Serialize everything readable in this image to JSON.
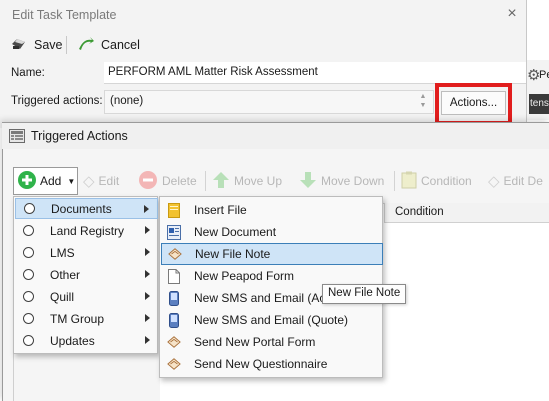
{
  "edit_window": {
    "title": "Edit Task Template",
    "close_glyph": "×",
    "toolbar": {
      "save_label": "Save",
      "cancel_label": "Cancel"
    },
    "name_label": "Name:",
    "name_value": "PERFORM AML Matter Risk Assessment",
    "triggered_actions_label": "Triggered actions:",
    "triggered_actions_value": "(none)",
    "actions_button": "Actions..."
  },
  "background_window": {
    "text": "Pe",
    "dark_text": "tensio"
  },
  "triggered_actions_window": {
    "title": "Triggered Actions",
    "toolbar": {
      "add": "Add",
      "edit": "Edit",
      "delete": "Delete",
      "move_up": "Move Up",
      "move_down": "Move Down",
      "condition": "Condition",
      "edit_de": "Edit De"
    },
    "grid": {
      "column_condition": "Condition"
    }
  },
  "add_menu": {
    "items": [
      {
        "label": "Documents",
        "selected": true
      },
      {
        "label": "Land Registry"
      },
      {
        "label": "LMS"
      },
      {
        "label": "Other"
      },
      {
        "label": "Quill"
      },
      {
        "label": "TM Group"
      },
      {
        "label": "Updates"
      }
    ]
  },
  "documents_submenu": {
    "items": [
      {
        "label": "Insert File",
        "icon": "folder-icon"
      },
      {
        "label": "New Document",
        "icon": "document-icon"
      },
      {
        "label": "New File Note",
        "icon": "file-note-icon",
        "selected": true
      },
      {
        "label": "New Peapod Form",
        "icon": "blank-page-icon"
      },
      {
        "label": "New SMS and Email (Act",
        "icon": "phone-icon"
      },
      {
        "label": "New SMS and Email (Quote)",
        "icon": "phone-icon"
      },
      {
        "label": "Send New Portal Form",
        "icon": "file-note-icon"
      },
      {
        "label": "Send New Questionnaire",
        "icon": "file-note-icon"
      }
    ]
  },
  "tooltip": {
    "text": "New File Note"
  },
  "colors": {
    "highlight": "#e11d1d",
    "selection": "#cfe4f7",
    "add_green": "#2fb34a"
  }
}
